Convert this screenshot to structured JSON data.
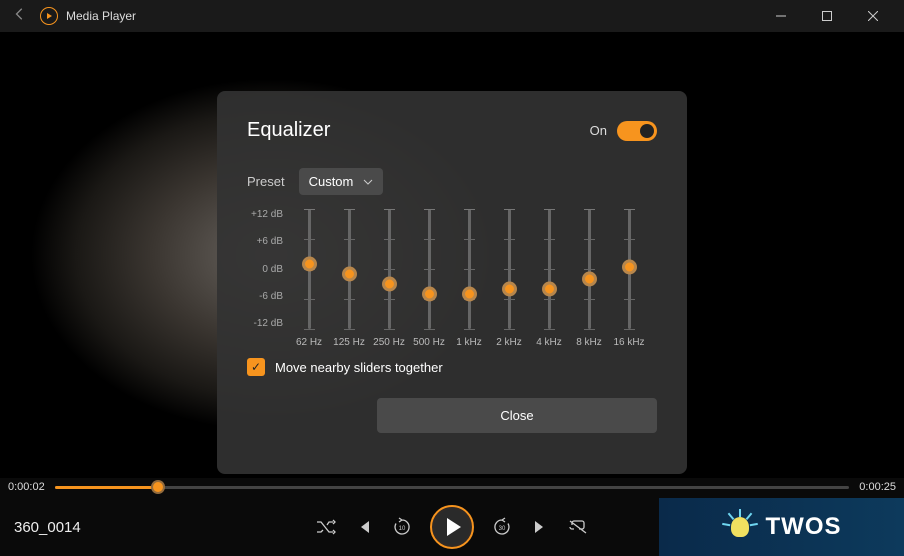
{
  "window": {
    "title": "Media Player"
  },
  "dialog": {
    "title": "Equalizer",
    "on_label": "On",
    "preset_label": "Preset",
    "preset_value": "Custom",
    "scale": [
      "+12 dB",
      "+6 dB",
      "0 dB",
      "-6 dB",
      "-12 dB"
    ],
    "bands": [
      {
        "label": "62 Hz",
        "value_db": 1
      },
      {
        "label": "125 Hz",
        "value_db": -1
      },
      {
        "label": "250 Hz",
        "value_db": -3
      },
      {
        "label": "500 Hz",
        "value_db": -5
      },
      {
        "label": "1 kHz",
        "value_db": -5
      },
      {
        "label": "2 kHz",
        "value_db": -4
      },
      {
        "label": "4 kHz",
        "value_db": -4
      },
      {
        "label": "8 kHz",
        "value_db": -2
      },
      {
        "label": "16 kHz",
        "value_db": 0.5
      }
    ],
    "move_together_label": "Move nearby sliders together",
    "move_together_checked": true,
    "close_label": "Close"
  },
  "player": {
    "elapsed": "0:00:02",
    "total": "0:00:25",
    "progress_pct": 13,
    "file_name": "360_0014",
    "skip_back_label": "10",
    "skip_fwd_label": "30"
  },
  "watermark": {
    "text": "TWOS"
  },
  "colors": {
    "accent": "#f7941e"
  }
}
